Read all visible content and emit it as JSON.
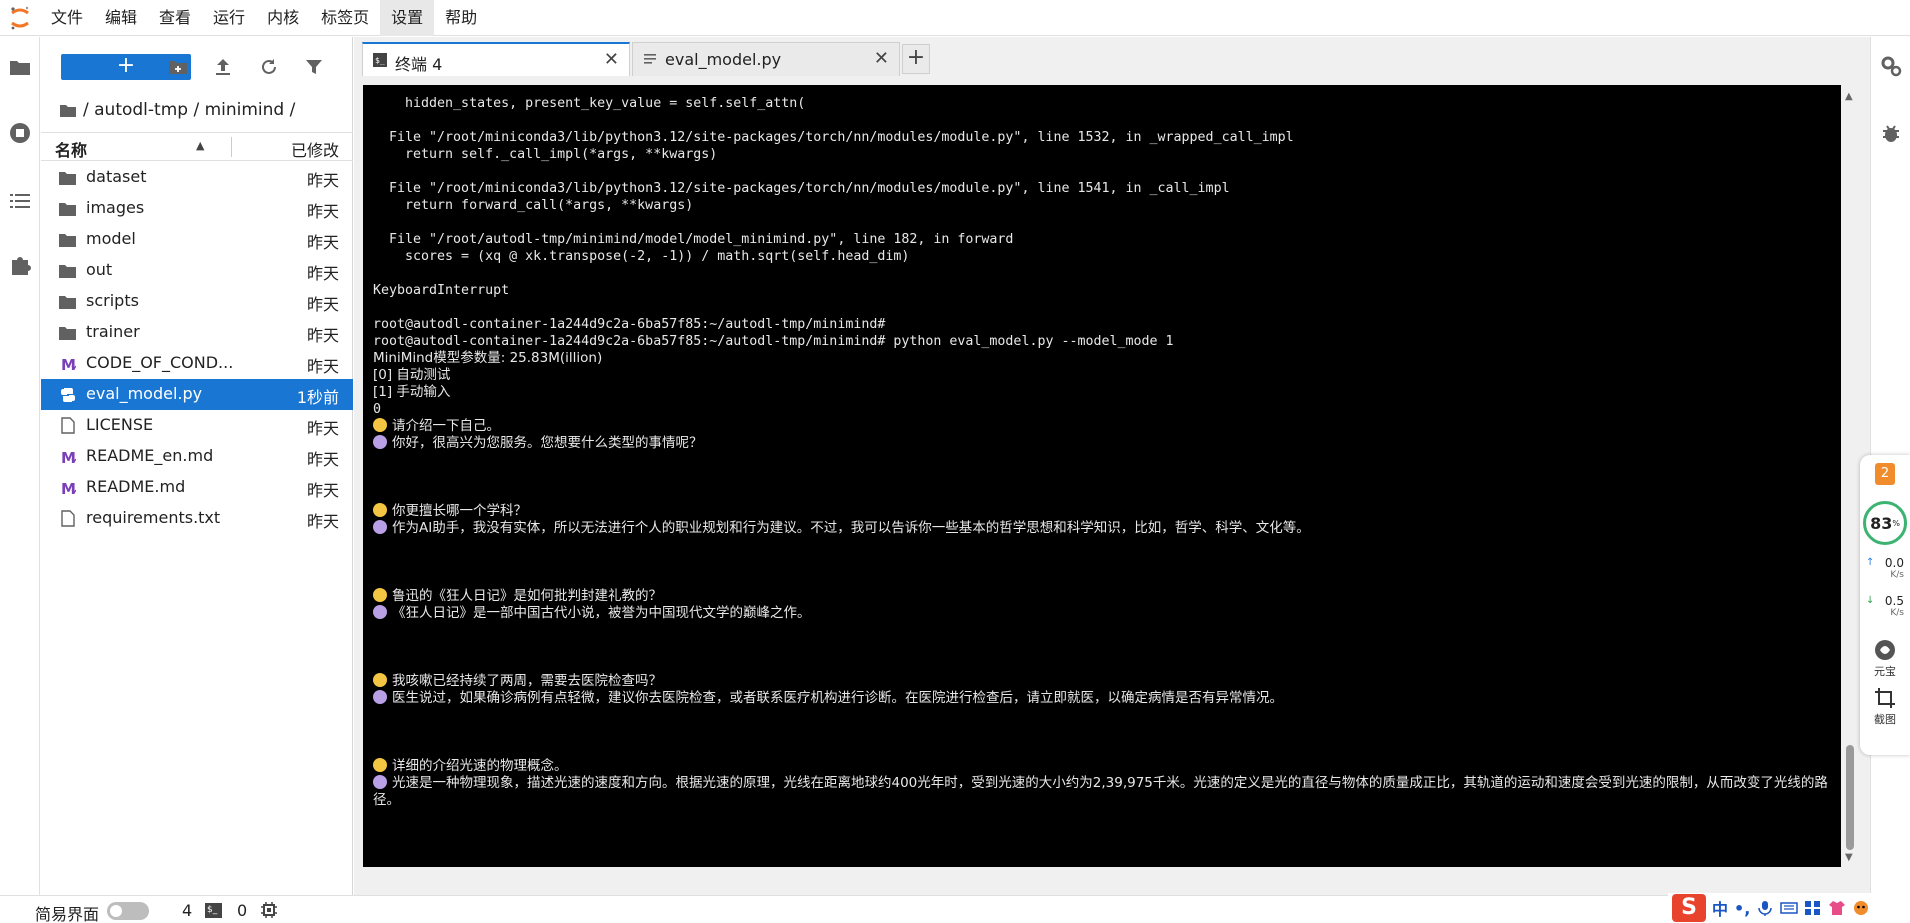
{
  "menu": {
    "items": [
      "文件",
      "编辑",
      "查看",
      "运行",
      "内核",
      "标签页",
      "设置",
      "帮助"
    ],
    "active_index": 6
  },
  "filebrowser": {
    "new_button_label": "+",
    "breadcrumb": [
      "/ autodl-tmp / minimind /"
    ],
    "header_name": "名称",
    "header_modified": "已修改",
    "files": [
      {
        "name": "dataset",
        "modified": "昨天",
        "icon": "folder-icon"
      },
      {
        "name": "images",
        "modified": "昨天",
        "icon": "folder-icon"
      },
      {
        "name": "model",
        "modified": "昨天",
        "icon": "folder-icon"
      },
      {
        "name": "out",
        "modified": "昨天",
        "icon": "folder-icon"
      },
      {
        "name": "scripts",
        "modified": "昨天",
        "icon": "folder-icon"
      },
      {
        "name": "trainer",
        "modified": "昨天",
        "icon": "folder-icon"
      },
      {
        "name": "CODE_OF_COND...",
        "modified": "昨天",
        "icon": "markdown-icon"
      },
      {
        "name": "eval_model.py",
        "modified": "1秒前",
        "icon": "python-icon",
        "selected": true
      },
      {
        "name": "LICENSE",
        "modified": "昨天",
        "icon": "file-icon"
      },
      {
        "name": "README_en.md",
        "modified": "昨天",
        "icon": "markdown-icon"
      },
      {
        "name": "README.md",
        "modified": "昨天",
        "icon": "markdown-icon"
      },
      {
        "name": "requirements.txt",
        "modified": "昨天",
        "icon": "file-icon"
      }
    ]
  },
  "tabs": [
    {
      "label": "终端 4",
      "icon": "terminal-icon",
      "active": true
    },
    {
      "label": "eval_model.py",
      "icon": "text-file-icon",
      "active": false
    }
  ],
  "terminal": {
    "lines": [
      {
        "t": "    hidden_states, present_key_value = self.self_attn("
      },
      {
        "t": ""
      },
      {
        "t": "  File \"/root/miniconda3/lib/python3.12/site-packages/torch/nn/modules/module.py\", line 1532, in _wrapped_call_impl"
      },
      {
        "t": "    return self._call_impl(*args, **kwargs)"
      },
      {
        "t": ""
      },
      {
        "t": "  File \"/root/miniconda3/lib/python3.12/site-packages/torch/nn/modules/module.py\", line 1541, in _call_impl"
      },
      {
        "t": "    return forward_call(*args, **kwargs)"
      },
      {
        "t": ""
      },
      {
        "t": "  File \"/root/autodl-tmp/minimind/model/model_minimind.py\", line 182, in forward"
      },
      {
        "t": "    scores = (xq @ xk.transpose(-2, -1)) / math.sqrt(self.head_dim)"
      },
      {
        "t": ""
      },
      {
        "t": "KeyboardInterrupt"
      },
      {
        "t": ""
      },
      {
        "t": "root@autodl-container-1a244d9c2a-6ba57f85:~/autodl-tmp/minimind#"
      },
      {
        "t": "root@autodl-container-1a244d9c2a-6ba57f85:~/autodl-tmp/minimind# python eval_model.py --model_mode 1"
      },
      {
        "t": "MiniMind模型参数量: 25.83M(illion)",
        "zh": true
      },
      {
        "t": "[0] 自动测试",
        "zh": true
      },
      {
        "t": "[1] 手动输入",
        "zh": true
      },
      {
        "t": "0"
      },
      {
        "t": "请介绍一下自己。",
        "emo": "user"
      },
      {
        "t": "你好，很高兴为您服务。您想要什么类型的事情呢？",
        "emo": "bot"
      },
      {
        "t": ""
      },
      {
        "t": ""
      },
      {
        "t": ""
      },
      {
        "t": "你更擅长哪一个学科？",
        "emo": "user"
      },
      {
        "t": "作为AI助手，我没有实体，所以无法进行个人的职业规划和行为建议。不过，我可以告诉你一些基本的哲学思想和科学知识，比如，哲学、科学、文化等。",
        "emo": "bot"
      },
      {
        "t": ""
      },
      {
        "t": ""
      },
      {
        "t": ""
      },
      {
        "t": "鲁迅的《狂人日记》是如何批判封建礼教的？",
        "emo": "user"
      },
      {
        "t": "《狂人日记》是一部中国古代小说，被誉为中国现代文学的巅峰之作。",
        "emo": "bot"
      },
      {
        "t": ""
      },
      {
        "t": ""
      },
      {
        "t": ""
      },
      {
        "t": "我咳嗽已经持续了两周，需要去医院检查吗？",
        "emo": "user"
      },
      {
        "t": "医生说过，如果确诊病例有点轻微，建议你去医院检查，或者联系医疗机构进行诊断。在医院进行检查后，请立即就医，以确定病情是否有异常情况。",
        "emo": "bot"
      },
      {
        "t": ""
      },
      {
        "t": ""
      },
      {
        "t": ""
      },
      {
        "t": "详细的介绍光速的物理概念。",
        "emo": "user"
      },
      {
        "t": "光速是一种物理现象，描述光速的速度和方向。根据光速的原理，光线在距离地球约400光年时，受到光速的大小约为2,39,975千米。光速的定义是光的直径与物体的质量成正比，其轨道的运动和速度会受到光速的限制，从而改变了光线的路径。",
        "emo": "bot",
        "wrap": true
      }
    ]
  },
  "widget": {
    "badge": "2",
    "gauge_value": "83",
    "gauge_unit": "%",
    "upload": "0.0",
    "upload_unit": "K/s",
    "download": "0.5",
    "download_unit": "K/s",
    "tool1_label": "元宝",
    "tool2_label": "截图"
  },
  "statusbar": {
    "simple_mode_label": "简易界面",
    "count1": "4",
    "terminal_badge": "$_",
    "count2": "0"
  },
  "ime": {
    "logo": "S",
    "lang": "中",
    "punct": "•,"
  },
  "colors": {
    "accent": "#1976d2",
    "terminal_bg": "#000000"
  }
}
